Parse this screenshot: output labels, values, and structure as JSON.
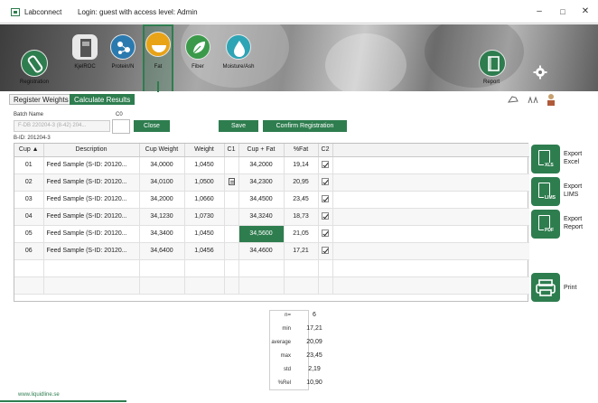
{
  "window": {
    "app_title": "Labconnect",
    "login": "Login: guest with access level: Admin",
    "minimize": "–",
    "maximize": "□",
    "close": "✕"
  },
  "nav": {
    "items": [
      {
        "label": "Registration"
      },
      {
        "label": "KjelROC"
      },
      {
        "label": "Protein/N"
      },
      {
        "label": "Fat"
      },
      {
        "label": "Fiber"
      },
      {
        "label": "Moisture/Ash"
      }
    ],
    "report": "Report"
  },
  "tabs": {
    "register": "Register Weights",
    "calculate": "Calculate Results"
  },
  "form": {
    "batch_label": "Batch Name",
    "batch_value": "F-DB 220204-3 (8-42) 204...",
    "c0_label": "C0",
    "batch_id": "B-ID: 201204-3",
    "close": "Close",
    "save": "Save",
    "confirm": "Confirm Registration"
  },
  "table": {
    "headers": [
      "Cup ▲",
      "Description",
      "Cup Weight",
      "Weight",
      "C1",
      "Cup + Fat",
      "%Fat",
      "C2"
    ],
    "rows": [
      {
        "cup": "01",
        "desc": "Feed Sample (S-ID: 20120...",
        "cupw": "34,0000",
        "w": "1,0450",
        "c1": "",
        "cf": "34,2000",
        "fat": "19,14",
        "c2": true
      },
      {
        "cup": "02",
        "desc": "Feed Sample (S-ID: 20120...",
        "cupw": "34,0100",
        "w": "1,0500",
        "c1": "note",
        "cf": "34,2300",
        "fat": "20,95",
        "c2": true
      },
      {
        "cup": "03",
        "desc": "Feed Sample (S-ID: 20120...",
        "cupw": "34,2000",
        "w": "1,0660",
        "c1": "",
        "cf": "34,4500",
        "fat": "23,45",
        "c2": true
      },
      {
        "cup": "04",
        "desc": "Feed Sample (S-ID: 20120...",
        "cupw": "34,1230",
        "w": "1,0730",
        "c1": "",
        "cf": "34,3240",
        "fat": "18,73",
        "c2": true
      },
      {
        "cup": "05",
        "desc": "Feed Sample (S-ID: 20120...",
        "cupw": "34,3400",
        "w": "1,0450",
        "c1": "",
        "cf": "34,5600",
        "fat": "21,05",
        "c2": true
      },
      {
        "cup": "06",
        "desc": "Feed Sample (S-ID: 20120...",
        "cupw": "34,6400",
        "w": "1,0456",
        "c1": "",
        "cf": "34,4600",
        "fat": "17,21",
        "c2": true
      }
    ]
  },
  "side_buttons": {
    "excel": "Export\nExcel",
    "excel_tag": "XLS",
    "lims": "Export\nLIMS",
    "lims_tag": "LIMS",
    "report": "Export\nReport",
    "report_tag": "PDF",
    "print": "Print"
  },
  "stats": [
    {
      "k": "n=",
      "v": "6"
    },
    {
      "k": "min",
      "v": "17,21"
    },
    {
      "k": "average",
      "v": "20,09"
    },
    {
      "k": "max",
      "v": "23,45"
    },
    {
      "k": "std",
      "v": "2,19"
    },
    {
      "k": "%Rel",
      "v": "10,90"
    }
  ],
  "footer": "www.liquidline.se",
  "colors": {
    "accent": "#2e7d4f"
  }
}
